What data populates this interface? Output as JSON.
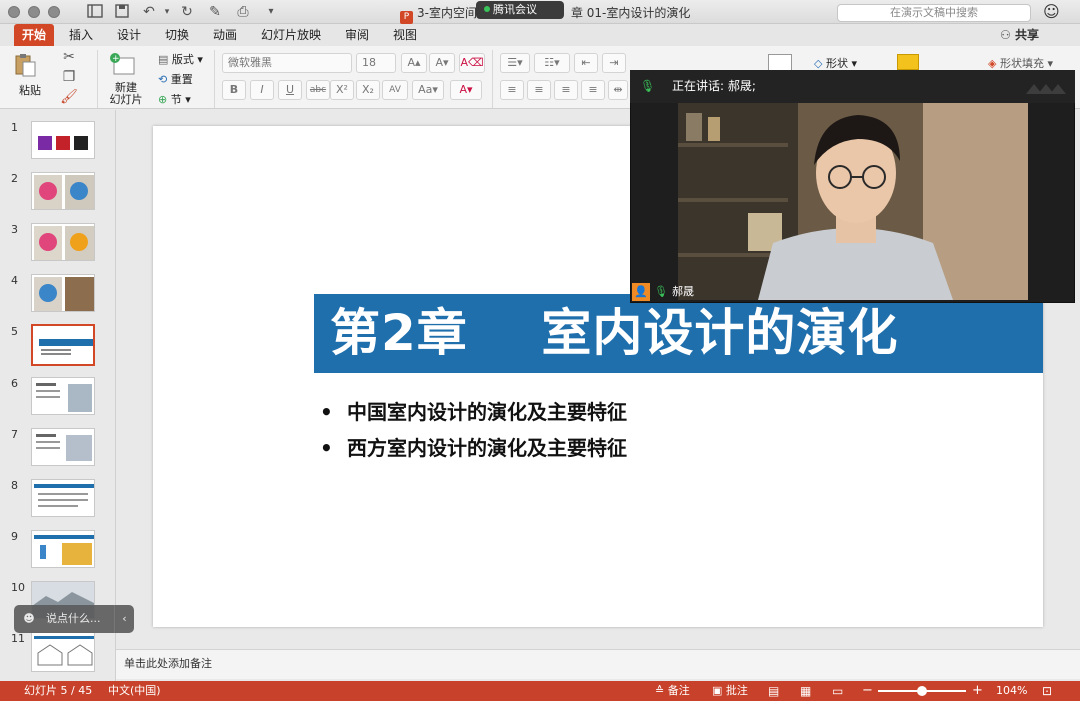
{
  "window": {
    "doc_title_left": "3-室内空间",
    "doc_title_right": "章 01-室内设计的演化",
    "ppt_badge": "P",
    "meeting_pill": "腾讯会议",
    "search_placeholder": "在演示文稿中搜索"
  },
  "tabs": [
    {
      "label": "开始",
      "active": true
    },
    {
      "label": "插入"
    },
    {
      "label": "设计"
    },
    {
      "label": "切换"
    },
    {
      "label": "动画"
    },
    {
      "label": "幻灯片放映"
    },
    {
      "label": "审阅"
    },
    {
      "label": "视图"
    }
  ],
  "share_label": "共享",
  "ribbon": {
    "paste": "粘贴",
    "new_slide_line1": "新建",
    "new_slide_line2": "幻灯片",
    "layout": "版式",
    "reset": "重置",
    "section": "节",
    "font_name": "微软雅黑",
    "font_size": "18",
    "shapes": "形状",
    "shape_fill": "形状填充"
  },
  "thumbnails": [
    {
      "num": "1"
    },
    {
      "num": "2"
    },
    {
      "num": "3"
    },
    {
      "num": "4"
    },
    {
      "num": "5",
      "selected": true
    },
    {
      "num": "6"
    },
    {
      "num": "7"
    },
    {
      "num": "8"
    },
    {
      "num": "9"
    },
    {
      "num": "10"
    },
    {
      "num": "11"
    }
  ],
  "slide": {
    "title": "第2章    室内设计的演化",
    "bullet_char": "•",
    "bullets": [
      "中国室内设计的演化及主要特征",
      "西方室内设计的演化及主要特征"
    ],
    "banner_color": "#1f6fad"
  },
  "notes_placeholder": "单击此处添加备注",
  "status": {
    "slide_counter": "幻灯片 5 / 45",
    "language": "中文(中国)",
    "notes": "备注",
    "comments": "批注",
    "zoom": "104%"
  },
  "video": {
    "speaking_label": "正在讲话: 郝晟;",
    "participant_name": "郝晟"
  },
  "chat": {
    "placeholder": "说点什么..."
  },
  "colors": {
    "accent": "#d24726",
    "status_bar": "#c8412a"
  }
}
